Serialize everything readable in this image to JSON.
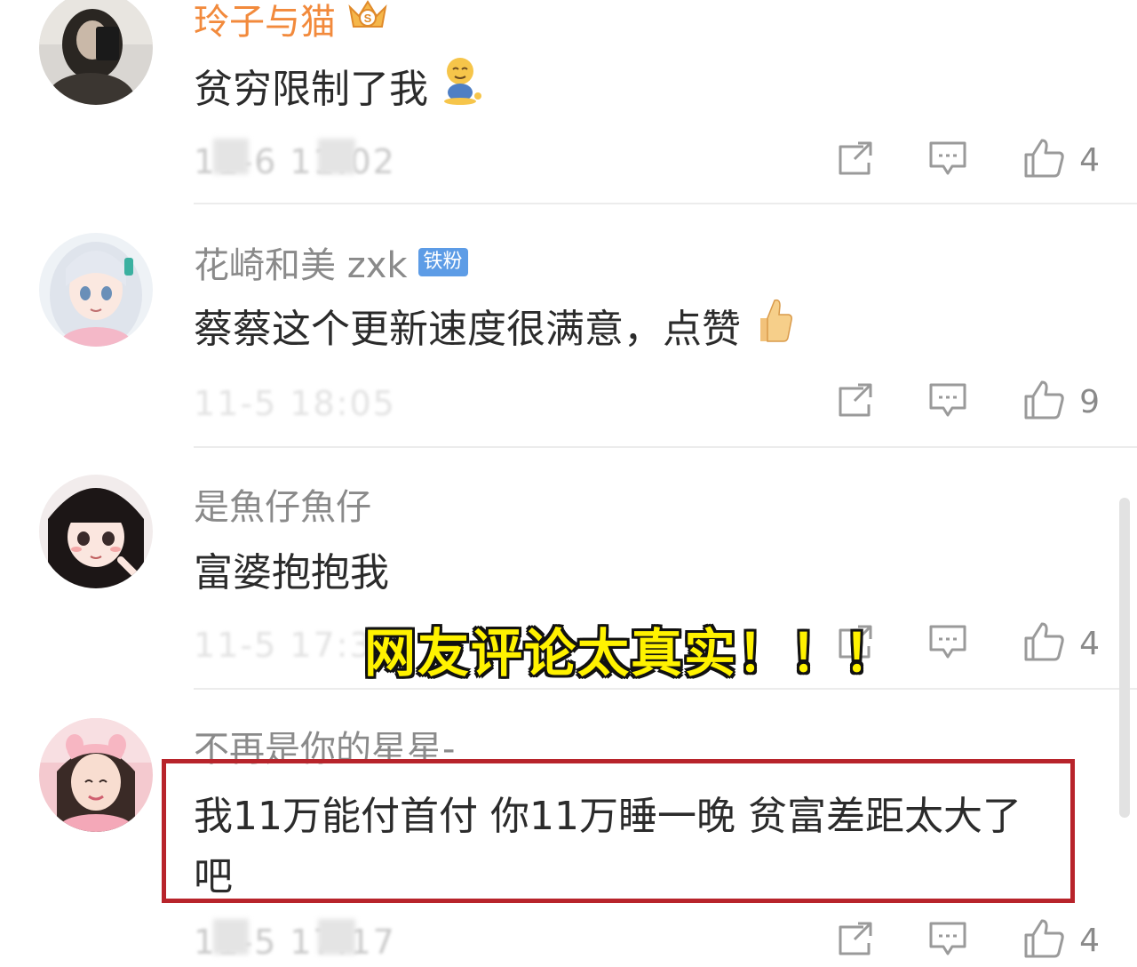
{
  "comments": [
    {
      "username": "玲子与猫",
      "badge": "crown-vip-icon",
      "text": "贫穷限制了我",
      "emoji": "shy-sitting-emoji",
      "time": "11-6 11:02",
      "likes": "4"
    },
    {
      "username": "花崎和美 zxk",
      "badge_label": "铁粉",
      "text": "蔡蔡这个更新速度很满意，点赞",
      "emoji": "thumbs-up-emoji",
      "time": "11-5 18:05",
      "likes": "9"
    },
    {
      "username": "是魚仔魚仔",
      "text": "富婆抱抱我",
      "time": "11-5 17:36",
      "likes": "4"
    },
    {
      "username": "不再是你的星星-",
      "text_line1": "我11万能付首付 你11万睡一晚 贫富差距太大了",
      "text_line2": "吧",
      "time": "11-5 17:17",
      "likes": "4"
    }
  ],
  "overlay": {
    "caption": "网友评论太真实！！！"
  },
  "colors": {
    "vip_name": "#f28a3c",
    "username": "#8a8a8a",
    "fan_badge": "#5d9ce6",
    "caption_fill": "#fff200",
    "highlight_border": "#b8242b"
  },
  "icons": {
    "share": "share-icon",
    "reply": "comment-icon",
    "like": "thumbs-up-icon"
  }
}
